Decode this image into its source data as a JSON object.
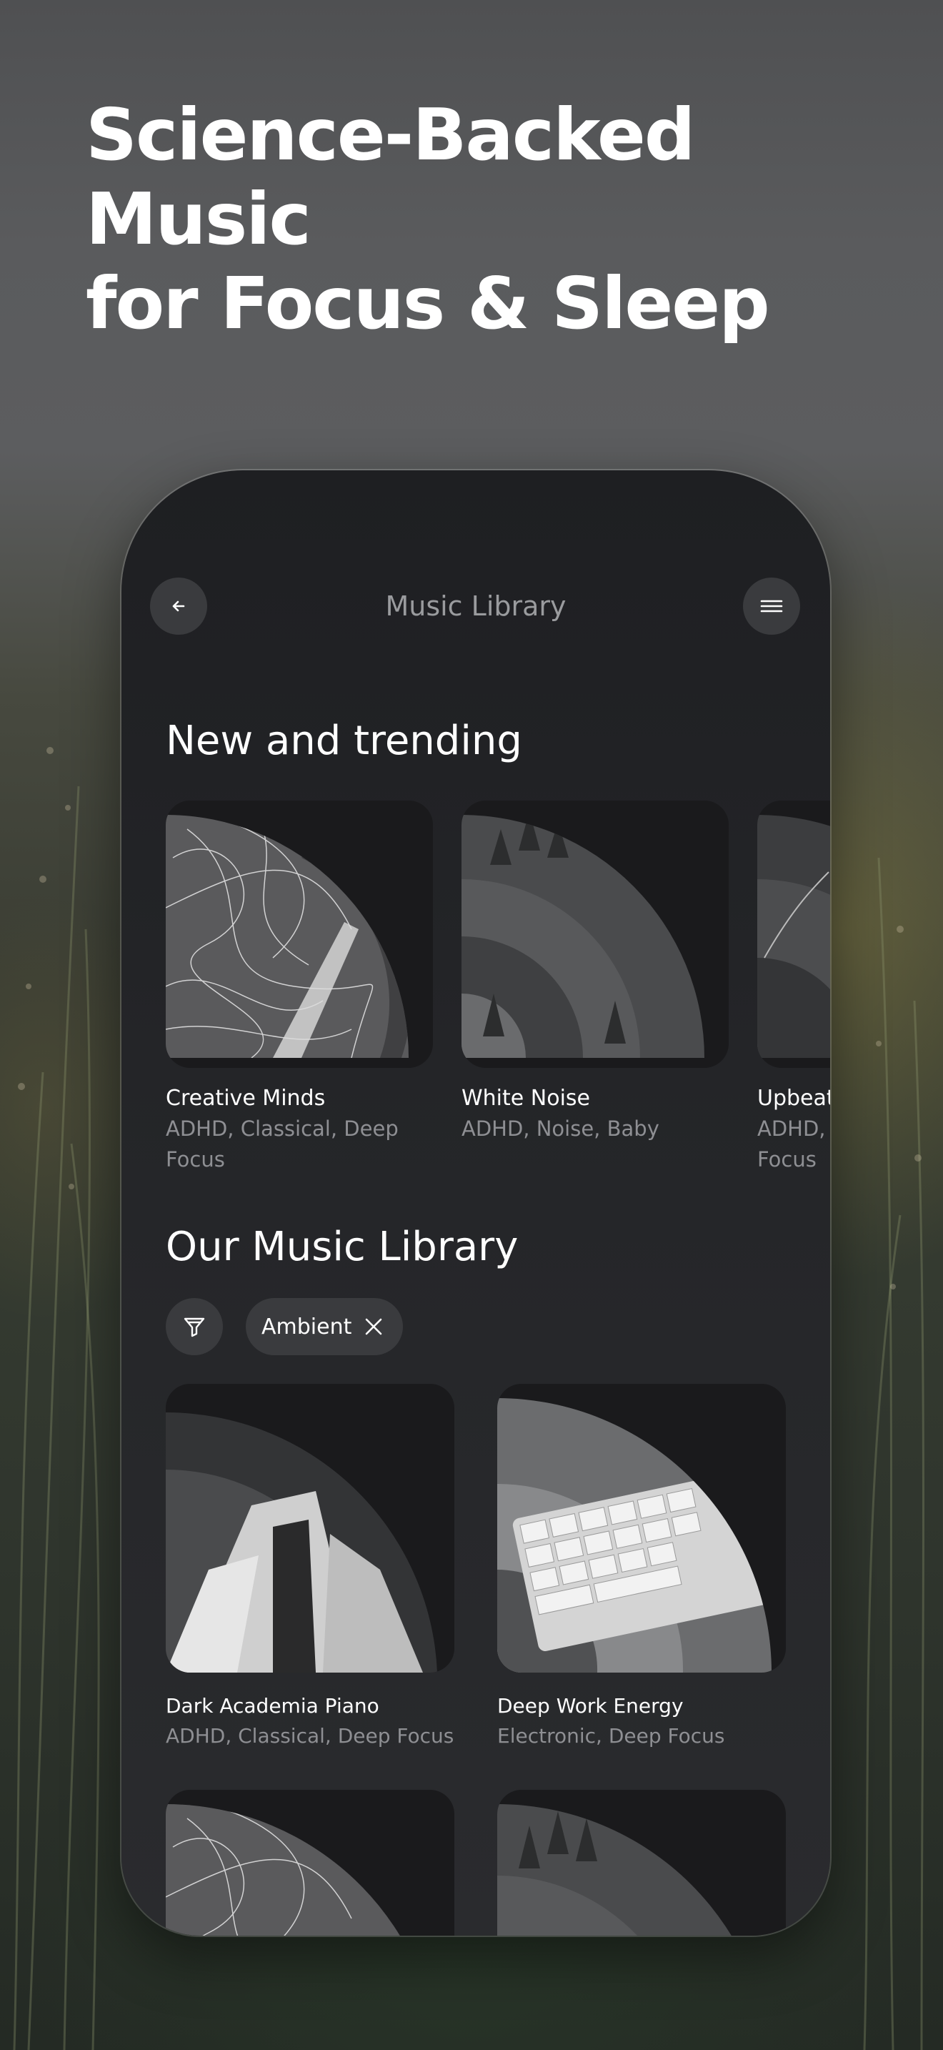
{
  "headline": {
    "line1": "Science-Backed Music",
    "line2": "for Focus & Sleep"
  },
  "header": {
    "back_icon": "arrow-left-icon",
    "title": "Music Library",
    "menu_icon": "hamburger-menu-icon"
  },
  "trending": {
    "title": "New and trending",
    "items": [
      {
        "title": "Creative Minds",
        "tags_line1": "ADHD, Classical, Deep",
        "tags_line2": "Focus"
      },
      {
        "title": "White Noise",
        "tags_line1": "ADHD, Noise, Baby",
        "tags_line2": ""
      },
      {
        "title": "Upbeat",
        "tags_line1": "ADHD,",
        "tags_line2": "Focus"
      }
    ]
  },
  "library": {
    "title": "Our Music Library",
    "filter_icon": "funnel-icon",
    "active_filter": "Ambient",
    "remove_icon": "close-icon",
    "items": [
      {
        "title": "Dark Academia Piano",
        "tags": "ADHD, Classical, Deep Focus"
      },
      {
        "title": "Deep Work Energy",
        "tags": "Electronic, Deep Focus"
      },
      {
        "title": "",
        "tags": ""
      },
      {
        "title": "",
        "tags": ""
      }
    ]
  },
  "colors": {
    "phone_bg": "#242528",
    "button_bg": "#3a3b3e",
    "muted_text": "#8e8f93"
  }
}
